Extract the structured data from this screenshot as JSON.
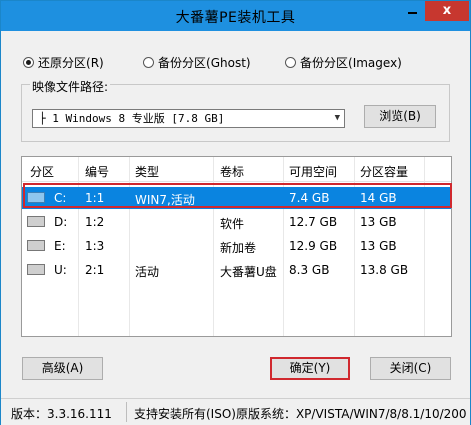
{
  "window": {
    "title": "大番薯PE装机工具",
    "close_glyph": "x"
  },
  "modes": [
    {
      "label": "还原分区",
      "shortcut": "(R)",
      "checked": true
    },
    {
      "label": "备份分区",
      "shortcut": "(Ghost)",
      "checked": false
    },
    {
      "label": "备份分区",
      "shortcut": "(Imagex)",
      "checked": false
    }
  ],
  "image_path": {
    "group_label": "映像文件路径:",
    "selected": "├ 1 Windows 8 专业版 [7.8 GB]",
    "browse_label": "浏览(B)"
  },
  "partition_table": {
    "columns": [
      "分区",
      "编号",
      "类型",
      "卷标",
      "可用空间",
      "分区容量"
    ],
    "rows": [
      {
        "drive": "C:",
        "number": "1:1",
        "type": "WIN7,活动",
        "label": "",
        "free": "7.4 GB",
        "capacity": "14 GB",
        "selected": true,
        "icon": "windows-drive-icon"
      },
      {
        "drive": "D:",
        "number": "1:2",
        "type": "",
        "label": "软件",
        "free": "12.7 GB",
        "capacity": "13 GB",
        "selected": false,
        "icon": "drive-icon"
      },
      {
        "drive": "E:",
        "number": "1:3",
        "type": "",
        "label": "新加卷",
        "free": "12.9 GB",
        "capacity": "13 GB",
        "selected": false,
        "icon": "drive-icon"
      },
      {
        "drive": "U:",
        "number": "2:1",
        "type": "活动",
        "label": "大番薯U盘",
        "free": "8.3 GB",
        "capacity": "13.8 GB",
        "selected": false,
        "icon": "usb-drive-icon"
      }
    ]
  },
  "buttons": {
    "advanced": "高级(A)",
    "ok": "确定(Y)",
    "close": "关闭(C)"
  },
  "status": {
    "version": "版本：3.3.16.111",
    "support": "支持安装所有(ISO)原版系统：XP/VISTA/WIN7/8/8.1/10/200"
  },
  "colors": {
    "titlebar": "#1e90e0",
    "selection": "#0a84e0",
    "highlight_border": "#d0282e"
  }
}
